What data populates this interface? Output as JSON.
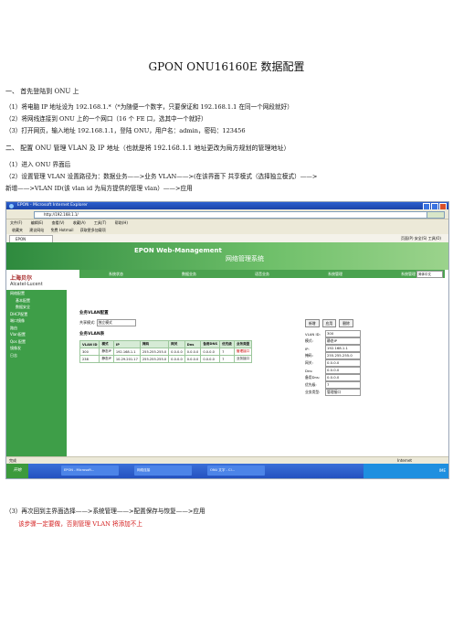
{
  "doc": {
    "title": "GPON ONU16160E 数据配置",
    "s1": "一、 首先登陆到 ONU 上",
    "s1_1": "（1）将电脑 IP 地址设为 192.168.1.*（*为随便一个数字，只要保证和 192.168.1.1 在同一个网段就好）",
    "s1_2": "（2）将网线连接到 ONU 上的一个网口（16 个 FE 口，选其中一个就好）",
    "s1_3": "（3）打开网页，输入地址 192.168.1.1，登陆 ONU，用户名：admin，密码：123456",
    "s2": "二、 配置 ONU 管理 VLAN 及 IP 地址（也就是将 192.168.1.1 地址更改为局方规划的管理地址）",
    "s2_1": "（1）进入 ONU 界面后",
    "s2_2a": "（2）设置管理 VLAN      设置路径为：数据业务——>业务 VLAN——>(在该界面下 共享模式（选择独立模式）——>",
    "s2_2b": "新增——>VLAN ID(该 vlan id 为局方提供的管理 vlan）——>应用",
    "s2_3": "（3）再次回到主界面选择——>系统管理——>配置保存与恢复——>应用",
    "s2_note": "该步骤一定要做，否则管理 VLAN 将添加不上"
  },
  "browser": {
    "window_title": "EPON - Microsoft Internet Explorer",
    "address": "http://192.168.1.1/",
    "menu": [
      "文件(F)",
      "编辑(E)",
      "查看(V)",
      "收藏(A)",
      "工具(T)",
      "帮助(H)"
    ],
    "favs": [
      "收藏夹",
      "建议网站",
      "免费 Hotmail",
      "获取更多加载项"
    ],
    "tab": "EPON",
    "tools": "页面(P)  安全(S)  工具(O)",
    "status_left": "完成",
    "status_right": "Internet"
  },
  "app": {
    "brand": "EPON  Web-Management",
    "system": "网络管理系统",
    "logo_cn": "上海贝尔",
    "logo_en": "Alcatel-Lucent",
    "nav": [
      "系统状态",
      "数据业务",
      "语音业务",
      "系统管理",
      "系统管理"
    ],
    "lang": "简体中文",
    "side": [
      "网络配置",
      "基本配置",
      "数据安全",
      "DHCP配置",
      "端口镜像",
      "路由",
      "Vlan配置",
      "Qos 配置",
      "镜像发",
      "日志"
    ],
    "section": "业务VLAN配置",
    "share_label": "共享模式:",
    "share_value": "独立模式",
    "table_title": "业务VLAN表",
    "headers": [
      "VLAN ID",
      "模式",
      "IP",
      "掩码",
      "网关",
      "Dns",
      "备用DNS",
      "优先级",
      "业务类型"
    ],
    "rows": [
      [
        "300",
        "静态IP",
        "192.168.1.1",
        "255.255.255.0",
        "0.0.0.0",
        "0.0.0.0",
        "0.0.0.0",
        "7",
        "管理接口"
      ],
      [
        "238",
        "静态IP",
        "10.29.201.17",
        "255.255.255.0",
        "0.0.0.0",
        "0.0.0.0",
        "0.0.0.0",
        "7",
        "业务接口"
      ]
    ],
    "buttons": [
      "新增",
      "应用",
      "删除"
    ],
    "form": [
      [
        "VLAN ID:",
        "300"
      ],
      [
        "模式:",
        "静态IP"
      ],
      [
        "IP:",
        "192.168.1.1"
      ],
      [
        "掩码:",
        "255.255.255.0"
      ],
      [
        "网关:",
        "0.0.0.0"
      ],
      [
        "Dns:",
        "0.0.0.0"
      ],
      [
        "备用Dns:",
        "0.0.0.0"
      ],
      [
        "优先级:",
        "7"
      ],
      [
        "业务类型:",
        "管理接口"
      ]
    ]
  },
  "taskbar": {
    "start": "开始",
    "items": [
      "EPON - Microsoft...",
      "网络连接",
      "ONU 文字 - Cl..."
    ],
    "clock": "IME"
  }
}
